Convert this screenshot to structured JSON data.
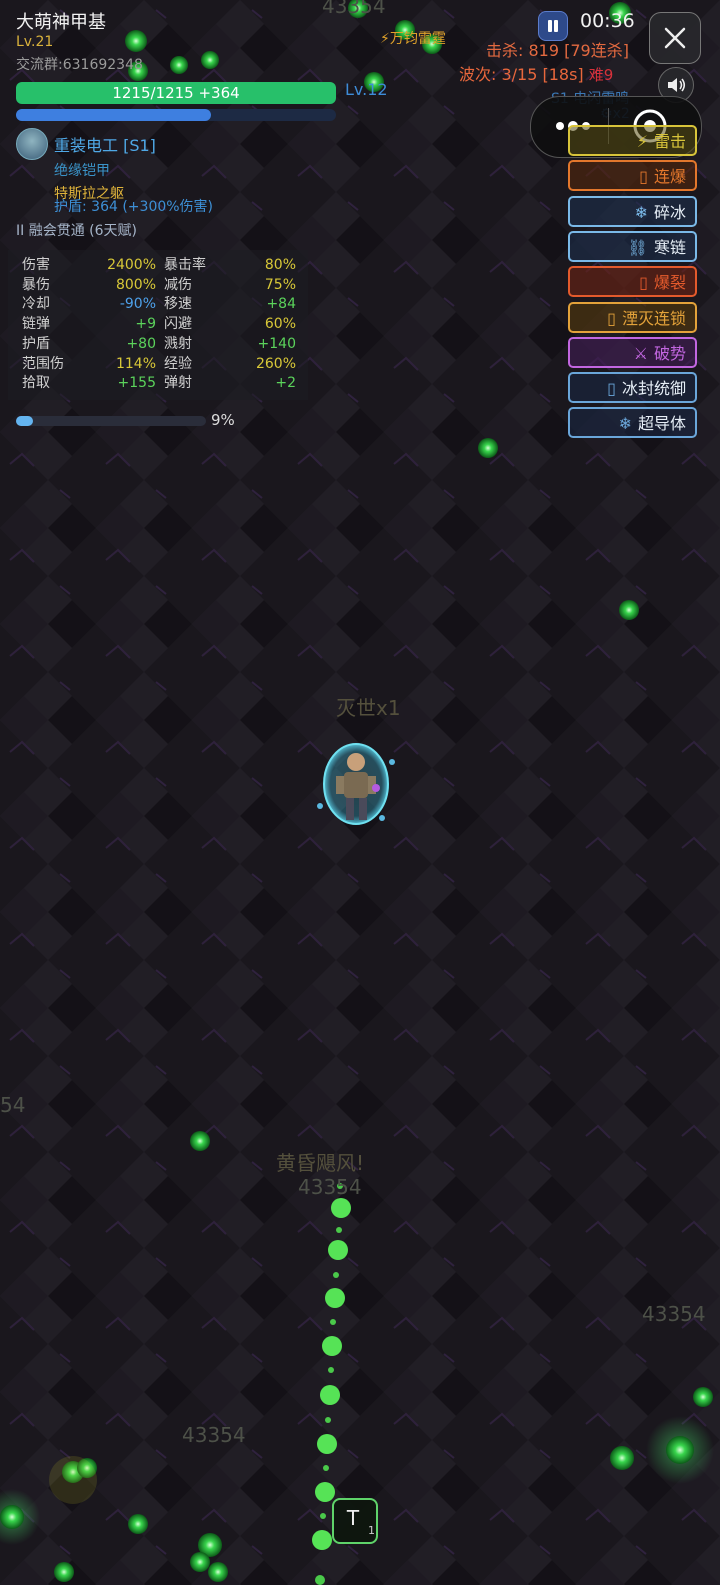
{
  "player": {
    "name": "大萌神甲基",
    "level": "Lv.21",
    "group": "交流群:631692348",
    "hp_text": "1215/1215 +364",
    "hp_fraction": 1.0,
    "exp_fraction": 0.61,
    "skill_level": "Lv.12",
    "class_name": "重装电工 [S1]",
    "armor": "绝缘铠甲",
    "relic": "特斯拉之躯",
    "shield": "护盾: 364 (+300%伤害)",
    "talent": "II 融会贯通 (6天赋)"
  },
  "stats": [
    {
      "n1": "伤害",
      "v1": "2400%",
      "c1": "#d8c838",
      "n2": "暴击率",
      "v2": "80%",
      "c2": "#d8c838"
    },
    {
      "n1": "暴伤",
      "v1": "800%",
      "c1": "#d8c838",
      "n2": "减伤",
      "v2": "75%",
      "c2": "#d8c838"
    },
    {
      "n1": "冷却",
      "v1": "-90%",
      "c1": "#4da0ea",
      "n2": "移速",
      "v2": "+84",
      "c2": "#5bd35b"
    },
    {
      "n1": "链弹",
      "v1": "+9",
      "c1": "#5bd35b",
      "n2": "闪避",
      "v2": "60%",
      "c2": "#d8c838"
    },
    {
      "n1": "护盾",
      "v1": "+80",
      "c1": "#5bd35b",
      "n2": "溅射",
      "v2": "+140",
      "c2": "#5bd35b"
    },
    {
      "n1": "范围伤",
      "v1": "114%",
      "c1": "#d8c838",
      "n2": "经验",
      "v2": "260%",
      "c2": "#d8c838"
    },
    {
      "n1": "拾取",
      "v1": "+155",
      "c1": "#5bd35b",
      "n2": "弹射",
      "v2": "+2",
      "c2": "#5bd35b"
    }
  ],
  "progress": {
    "text": "9%",
    "fraction": 0.09
  },
  "hud": {
    "timer": "00:36",
    "kills": "击杀: 819 [79连杀]",
    "wave": "波次: 3/15 [18s]",
    "difficulty": "难9",
    "skill_info": "S1 电闪雷鸣",
    "skill_count": "x2",
    "thunder": "⚡万钧雷霆"
  },
  "skills": [
    {
      "label": "雷击",
      "icon": "⚡",
      "color": "#d8c43a",
      "bg": "rgba(90,80,20,0.55)"
    },
    {
      "label": "连爆",
      "icon": "▯",
      "color": "#e3772c",
      "bg": "rgba(90,40,10,0.55)"
    },
    {
      "label": "碎冰",
      "icon": "❄",
      "color": "#7ab9e8",
      "bg": "rgba(30,50,80,0.55)"
    },
    {
      "label": "寒链",
      "icon": "⛓",
      "color": "#7ab9e8",
      "bg": "rgba(30,50,80,0.55)"
    },
    {
      "label": "爆裂",
      "icon": "▯",
      "color": "#e35a2c",
      "bg": "rgba(110,35,20,0.6)"
    },
    {
      "label": "湮灭连锁",
      "icon": "▯",
      "color": "#e3a23a",
      "bg": "rgba(90,60,10,0.55)"
    },
    {
      "label": "破势",
      "icon": "⚔",
      "color": "#c266e0",
      "bg": "rgba(70,30,90,0.55)"
    },
    {
      "label": "冰封统御",
      "icon": "▯",
      "color": "#6aa6da",
      "bg": "rgba(25,40,70,0.55)"
    },
    {
      "label": "超导体",
      "icon": "❄",
      "color": "#6aa6da",
      "bg": "rgba(25,40,70,0.55)"
    }
  ],
  "floats": {
    "top_damage": "43354",
    "mid_label": "灭世x1",
    "lower_label": "黄昏飓风!",
    "lower_damage": "43354",
    "right_damage": "43354",
    "left_damage": "43354",
    "edge_damage": "54"
  },
  "bottom_button": {
    "label": "T",
    "sub": "1"
  }
}
